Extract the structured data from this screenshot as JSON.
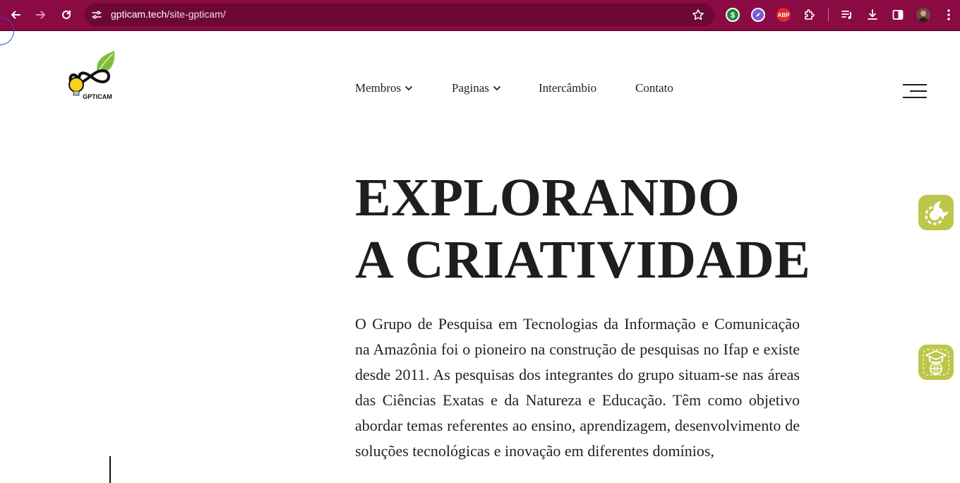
{
  "browser": {
    "url_host": "gpticam.tech",
    "url_path": "/site-gpticam/"
  },
  "site": {
    "logo_text": "GPTICAM",
    "menu": [
      {
        "label": "Membros",
        "has_dropdown": true
      },
      {
        "label": "Paginas",
        "has_dropdown": true
      },
      {
        "label": "Intercâmbio",
        "has_dropdown": false
      },
      {
        "label": "Contato",
        "has_dropdown": false
      }
    ]
  },
  "hero": {
    "title_line1": "EXPLORANDO",
    "title_line2": "A CRIATIVIDADE",
    "paragraph": "O Grupo de Pesquisa em Tecnologias da Informação e Comunicação na Amazônia foi o pioneiro na construção de pesquisas no Ifap e existe desde 2011. As pesquisas dos integrantes do grupo situam-se nas áreas das Ciências Exatas e da Natureza e Educação. Têm como objetivo abordar temas referentes ao ensino, aprendizagem, desenvolvimento de soluções tecnológicas e inovação em diferentes domínios,"
  },
  "icons": {
    "back": "arrow-left-icon",
    "forward": "arrow-right-icon",
    "reload": "reload-icon",
    "site_info": "tune-icon",
    "bookmark": "star-icon",
    "extensions": [
      "dollar-extension-icon",
      "compass-extension-icon",
      "adblock-extension-icon",
      "puzzle-icon"
    ],
    "toolbar": [
      "media-queue-icon",
      "download-icon",
      "side-panel-icon",
      "profile-avatar",
      "kebab-menu-icon"
    ],
    "floating": [
      "dark-mode-gear-icon",
      "education-globe-icon"
    ]
  },
  "colors": {
    "chrome": "#8a0a43",
    "omnibox": "#6d0735",
    "accent_green": "#bcc74a",
    "text": "#1e1e1e"
  },
  "extension_labels": {
    "adblock": "ABP"
  }
}
